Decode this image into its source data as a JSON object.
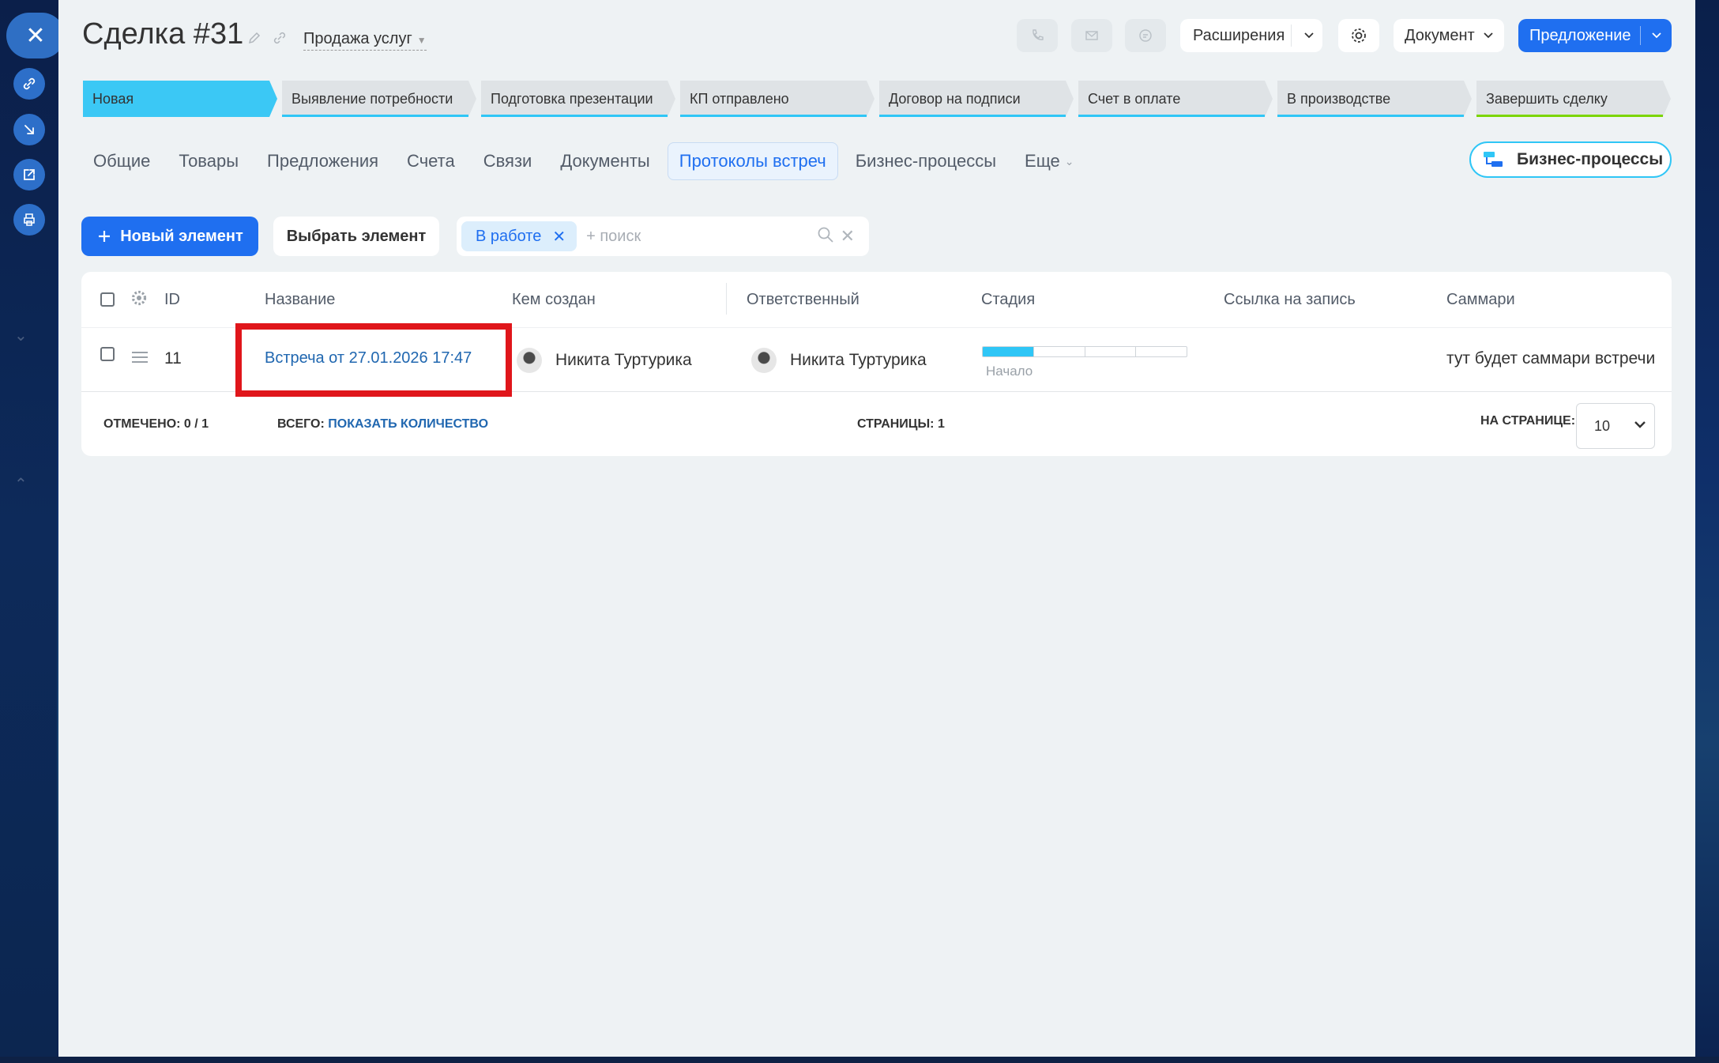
{
  "header": {
    "title": "Сделка #31",
    "category": "Продажа услуг",
    "extensions_label": "Расширения",
    "document_label": "Документ",
    "offer_label": "Предложение"
  },
  "stages": [
    {
      "label": "Новая",
      "color": "#2fc6f6",
      "active": true
    },
    {
      "label": "Выявление потребности",
      "color": "#2fc6f6"
    },
    {
      "label": "Подготовка презентации",
      "color": "#2fc6f6"
    },
    {
      "label": "КП отправлено",
      "color": "#2fc6f6"
    },
    {
      "label": "Договор на подписи",
      "color": "#2fc6f6"
    },
    {
      "label": "Счет в оплате",
      "color": "#2fc6f6"
    },
    {
      "label": "В производстве",
      "color": "#2fc6f6"
    },
    {
      "label": "Завершить сделку",
      "color": "#7bd500"
    }
  ],
  "tabs": [
    {
      "label": "Общие"
    },
    {
      "label": "Товары"
    },
    {
      "label": "Предложения"
    },
    {
      "label": "Счета"
    },
    {
      "label": "Связи"
    },
    {
      "label": "Документы"
    },
    {
      "label": "Протоколы встреч",
      "active": true
    },
    {
      "label": "Бизнес-процессы"
    },
    {
      "label": "Еще"
    }
  ],
  "bp_button_label": "Бизнес-процессы",
  "toolbar": {
    "new_element": "Новый элемент",
    "select_element": "Выбрать элемент",
    "filter_chip": "В работе",
    "search_placeholder": "+ поиск"
  },
  "grid": {
    "columns": {
      "id": "ID",
      "name": "Название",
      "created_by": "Кем создан",
      "responsible": "Ответственный",
      "stage": "Стадия",
      "record_link": "Ссылка на запись",
      "summary": "Саммари"
    },
    "rows": [
      {
        "id": "11",
        "name": "Встреча от 27.01.2026 17:47",
        "created_by": "Никита Туртурика",
        "responsible": "Никита Туртурика",
        "stage": "Начало",
        "stage_progress": 0.25,
        "record_link": "",
        "summary": "тут будет саммари встречи"
      }
    ],
    "footer": {
      "checked_label": "ОТМЕЧЕНО:",
      "checked_value": "0 / 1",
      "total_label": "ВСЕГО:",
      "total_link": "ПОКАЗАТЬ КОЛИЧЕСТВО",
      "pages_label": "СТРАНИЦЫ:",
      "pages_value": "1",
      "per_page_label": "НА СТРАНИЦЕ:",
      "per_page_value": "10"
    }
  }
}
